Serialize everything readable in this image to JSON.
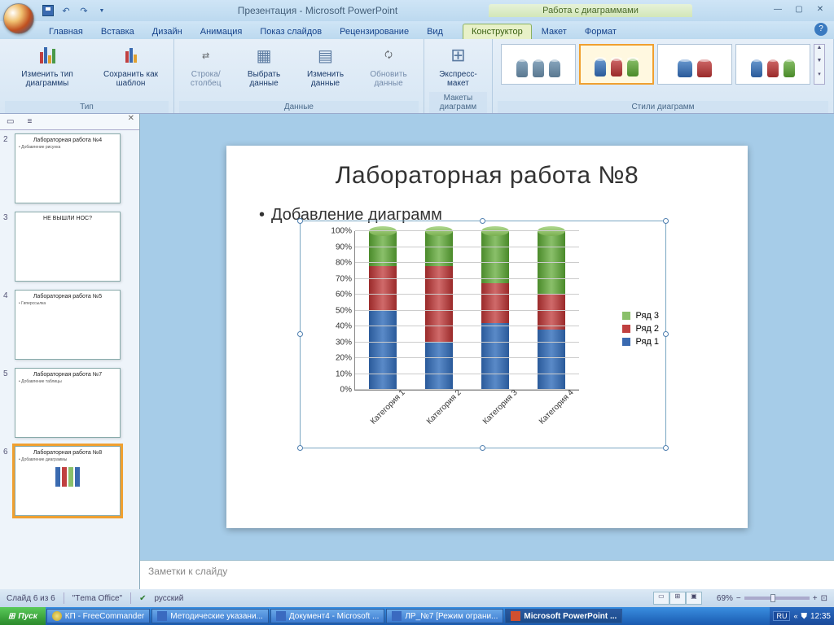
{
  "app": {
    "title": "Презентация - Microsoft PowerPoint",
    "context_title": "Работа с диаграммами"
  },
  "tabs": {
    "items": [
      "Главная",
      "Вставка",
      "Дизайн",
      "Анимация",
      "Показ слайдов",
      "Рецензирование",
      "Вид"
    ],
    "context": [
      "Конструктор",
      "Макет",
      "Формат"
    ],
    "active": "Конструктор"
  },
  "ribbon": {
    "groups": {
      "type": {
        "label": "Тип",
        "change_type": "Изменить тип диаграммы",
        "save_template": "Сохранить как шаблон"
      },
      "data": {
        "label": "Данные",
        "switch_rowcol": "Строка/столбец",
        "select_data": "Выбрать данные",
        "edit_data": "Изменить данные",
        "refresh_data": "Обновить данные"
      },
      "layouts": {
        "label": "Макеты диаграмм",
        "quick_layout": "Экспресс-макет"
      },
      "styles": {
        "label": "Стили диаграмм"
      }
    }
  },
  "slides": {
    "items": [
      {
        "num": "2",
        "title": "Лабораторная работа №4",
        "sub": "• Добавление рисунка"
      },
      {
        "num": "3",
        "title": "НЕ ВЫШЛИ НОС?"
      },
      {
        "num": "4",
        "title": "Лабораторная работа №5",
        "sub": "• Гиперссылка"
      },
      {
        "num": "5",
        "title": "Лабораторная работа №7",
        "sub": "• Добавление таблицы"
      },
      {
        "num": "6",
        "title": "Лабораторная работа №8",
        "sub": "• Добавление диаграммы"
      }
    ],
    "active": 4
  },
  "slide": {
    "title": "Лабораторная работа №8",
    "bullet": "Добавление диаграмм"
  },
  "chart_data": {
    "type": "bar",
    "stacked": true,
    "percent": true,
    "categories": [
      "Категория 1",
      "Категория 2",
      "Категория 3",
      "Категория 4"
    ],
    "series": [
      {
        "name": "Ряд 1",
        "values": [
          50,
          30,
          42,
          38
        ]
      },
      {
        "name": "Ряд 2",
        "values": [
          28,
          48,
          25,
          22
        ]
      },
      {
        "name": "Ряд 3",
        "values": [
          22,
          22,
          33,
          40
        ]
      }
    ],
    "ylim": [
      0,
      100
    ],
    "yticks": [
      "0%",
      "10%",
      "20%",
      "30%",
      "40%",
      "50%",
      "60%",
      "70%",
      "80%",
      "90%",
      "100%"
    ],
    "legend": [
      "Ряд 3",
      "Ряд 2",
      "Ряд 1"
    ]
  },
  "notes": {
    "placeholder": "Заметки к слайду"
  },
  "status": {
    "slide_of": "Слайд 6 из 6",
    "theme": "\"Тema Office\"",
    "lang": "русский",
    "zoom": "69%"
  },
  "taskbar": {
    "start": "Пуск",
    "items": [
      "КП - FreeCommander",
      "Методические указани...",
      "Документ4 - Microsoft ...",
      "ЛР_№7 [Режим ограни...",
      "Microsoft PowerPoint ..."
    ],
    "lang": "RU",
    "clock": "12:35"
  }
}
